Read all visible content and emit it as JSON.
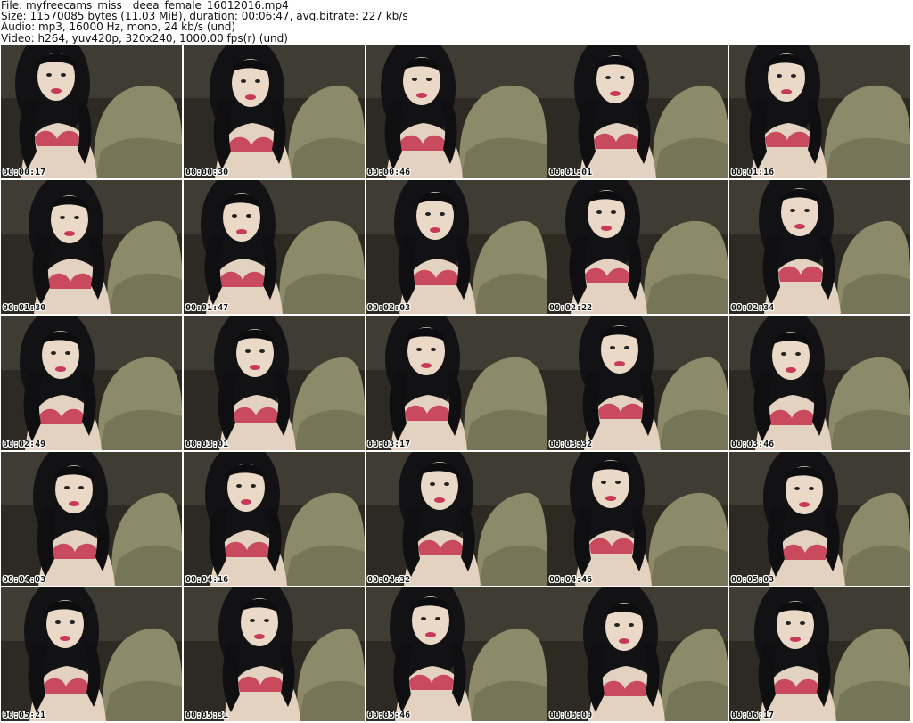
{
  "header": {
    "line1": "File: myfreecams_miss__deea_female_16012016.mp4",
    "line2": "Size: 11570085 bytes (11.03 MiB), duration: 00:06:47, avg.bitrate: 227 kb/s",
    "line3": "Audio: mp3, 16000 Hz, mono, 24 kb/s (und)",
    "line4": "Video: h264, yuv420p, 320x240, 1000.00 fps(r) (und)"
  },
  "thumbnails": [
    {
      "timestamp": "00:00:17"
    },
    {
      "timestamp": "00:00:30"
    },
    {
      "timestamp": "00:00:46"
    },
    {
      "timestamp": "00:01:01"
    },
    {
      "timestamp": "00:01:16"
    },
    {
      "timestamp": "00:01:30"
    },
    {
      "timestamp": "00:01:47"
    },
    {
      "timestamp": "00:02:03"
    },
    {
      "timestamp": "00:02:22"
    },
    {
      "timestamp": "00:02:34"
    },
    {
      "timestamp": "00:02:49"
    },
    {
      "timestamp": "00:03:01"
    },
    {
      "timestamp": "00:03:17"
    },
    {
      "timestamp": "00:03:32"
    },
    {
      "timestamp": "00:03:46"
    },
    {
      "timestamp": "00:04:03"
    },
    {
      "timestamp": "00:04:16"
    },
    {
      "timestamp": "00:04:32"
    },
    {
      "timestamp": "00:04:46"
    },
    {
      "timestamp": "00:05:03"
    },
    {
      "timestamp": "00:05:21"
    },
    {
      "timestamp": "00:05:31"
    },
    {
      "timestamp": "00:05:46"
    },
    {
      "timestamp": "00:06:00"
    },
    {
      "timestamp": "00:06:17"
    }
  ]
}
